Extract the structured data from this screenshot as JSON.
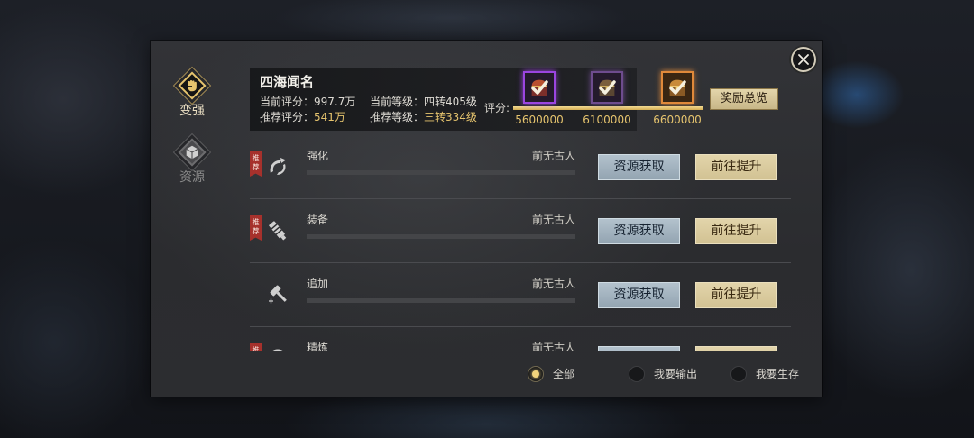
{
  "sidebar": {
    "tabs": [
      {
        "label": "变强",
        "icon": "fist-icon",
        "active": true
      },
      {
        "label": "资源",
        "icon": "box-icon",
        "active": false
      }
    ]
  },
  "header": {
    "title": "四海闻名",
    "current_score": {
      "label": "当前评分：",
      "value": "997.7万"
    },
    "current_level": {
      "label": "当前等级：",
      "value": "四转405级"
    },
    "recommended_score": {
      "label": "推荐评分：",
      "value": "541万"
    },
    "recommended_level": {
      "label": "推荐等级：",
      "value": "三转334级"
    }
  },
  "score_rewards": {
    "label": "评分:",
    "progress": 1,
    "milestones": [
      {
        "value": "5600000",
        "icon": "chest-icon",
        "frame_color": "#9b45e0",
        "claimed": true
      },
      {
        "value": "6100000",
        "icon": "chest-icon",
        "frame_color": "#6e4c8e",
        "claimed": true
      },
      {
        "value": "6600000",
        "icon": "chest-icon",
        "frame_color": "#e0893a",
        "claimed": true
      }
    ],
    "overview_button": "奖励总览"
  },
  "list": {
    "rows": [
      {
        "name": "强化",
        "status": "前无古人",
        "badge": "推荐",
        "icon": "enhance-icon",
        "acquire_button": "资源获取",
        "upgrade_button": "前往提升"
      },
      {
        "name": "装备",
        "status": "前无古人",
        "badge": "推荐",
        "icon": "equipment-icon",
        "acquire_button": "资源获取",
        "upgrade_button": "前往提升"
      },
      {
        "name": "追加",
        "status": "前无古人",
        "icon": "hammer-icon",
        "acquire_button": "资源获取",
        "upgrade_button": "前往提升"
      },
      {
        "name": "精炼",
        "status": "前无古人",
        "badge": "推荐",
        "icon": "refine-icon"
      }
    ]
  },
  "filters": {
    "options": [
      {
        "label": "全部",
        "selected": true
      },
      {
        "label": "我要输出",
        "selected": false
      },
      {
        "label": "我要生存",
        "selected": false
      }
    ]
  },
  "close": {
    "icon": "close-icon"
  },
  "colors": {
    "gold": "#e6c46e",
    "badge_red": "#a6312c",
    "acquire_btn": "#93a4b1",
    "upgrade_btn": "#d2c293"
  }
}
